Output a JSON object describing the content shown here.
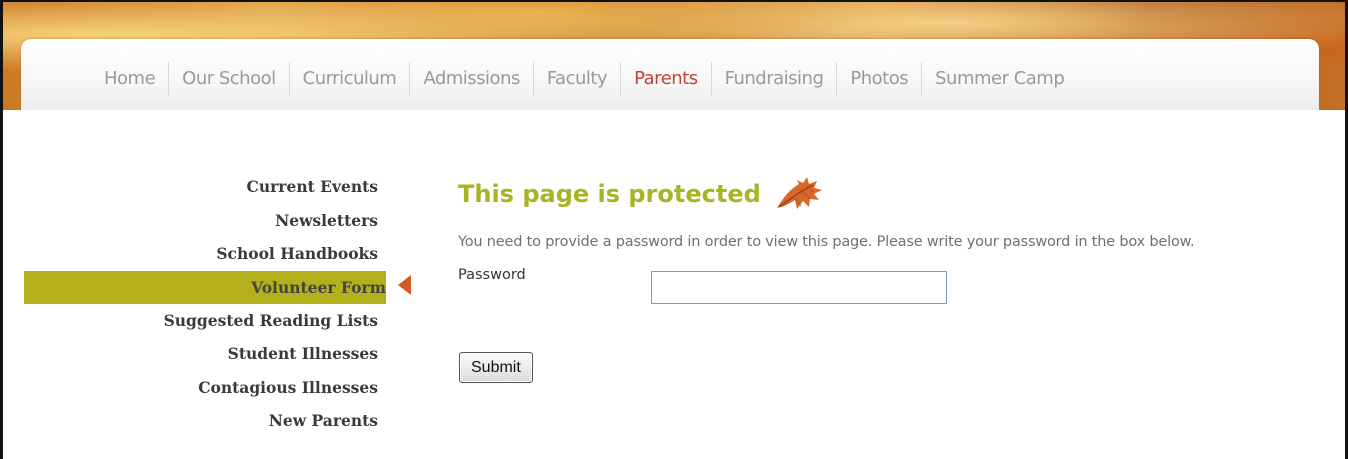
{
  "nav": {
    "items": [
      {
        "label": "Home"
      },
      {
        "label": "Our School"
      },
      {
        "label": "Curriculum"
      },
      {
        "label": "Admissions"
      },
      {
        "label": "Faculty"
      },
      {
        "label": "Parents",
        "active": true
      },
      {
        "label": "Fundraising"
      },
      {
        "label": "Photos"
      },
      {
        "label": "Summer Camp"
      }
    ]
  },
  "sidebar": {
    "items": [
      {
        "label": "Current Events"
      },
      {
        "label": "Newsletters"
      },
      {
        "label": "School Handbooks"
      },
      {
        "label": "Volunteer Form",
        "active": true
      },
      {
        "label": "Suggested Reading Lists"
      },
      {
        "label": "Student Illnesses"
      },
      {
        "label": "Contagious Illnesses"
      },
      {
        "label": "New Parents"
      }
    ]
  },
  "main": {
    "title": "This page is protected",
    "title_icon": "autumn-leaf-icon",
    "message": "You need to provide a password in order to view this page. Please write your password in the box below.",
    "password_label": "Password",
    "password_value": "",
    "submit_label": "Submit"
  },
  "colors": {
    "title": "#a9b423",
    "active_sidebar_bg": "#b3b01b",
    "active_nav": "#c0443a",
    "arrow": "#d4581f"
  }
}
